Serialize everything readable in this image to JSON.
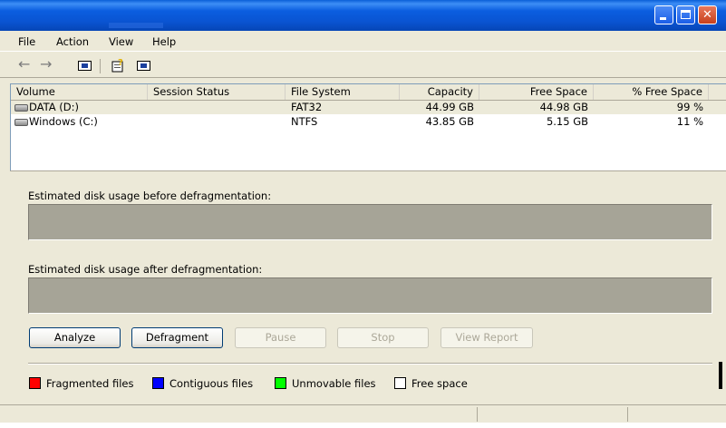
{
  "menu": [
    "File",
    "Action",
    "View",
    "Help"
  ],
  "toolbar": {
    "back_icon": "back-arrow-icon",
    "forward_icon": "forward-arrow-icon"
  },
  "columns": [
    "Volume",
    "Session Status",
    "File System",
    "Capacity",
    "Free Space",
    "% Free Space"
  ],
  "volumes": [
    {
      "volume": "DATA (D:)",
      "status": "",
      "fs": "FAT32",
      "capacity": "44.99 GB",
      "free": "44.98 GB",
      "pct": "99 %"
    },
    {
      "volume": "Windows (C:)",
      "status": "",
      "fs": "NTFS",
      "capacity": "43.85 GB",
      "free": "5.15 GB",
      "pct": "11 %"
    }
  ],
  "before_label": "Estimated disk usage before defragmentation:",
  "after_label": "Estimated disk usage after defragmentation:",
  "buttons": {
    "analyze": "Analyze",
    "defragment": "Defragment",
    "pause": "Pause",
    "stop": "Stop",
    "view_report": "View Report"
  },
  "legend": [
    {
      "label": "Fragmented files",
      "color": "#ff0000"
    },
    {
      "label": "Contiguous files",
      "color": "#0000ff"
    },
    {
      "label": "Unmovable files",
      "color": "#00ff00"
    },
    {
      "label": "Free space",
      "color": "#ffffff"
    }
  ]
}
